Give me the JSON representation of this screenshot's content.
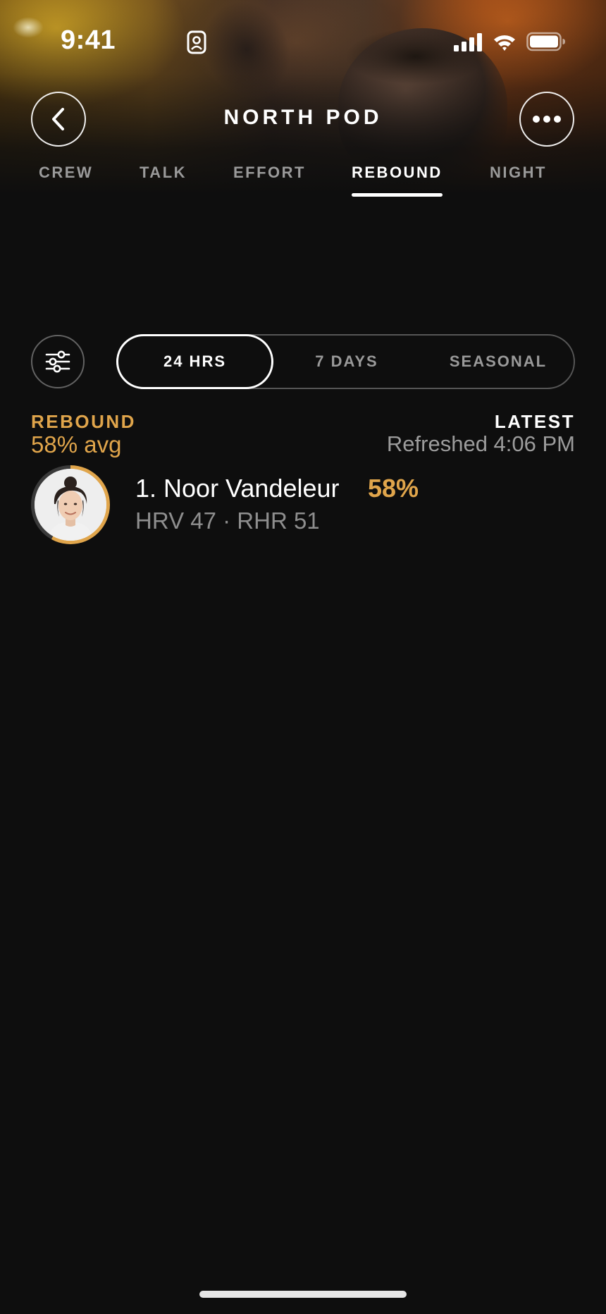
{
  "status_bar": {
    "time": "9:41",
    "icons": [
      "contact-card-icon",
      "cellular-signal-icon",
      "wifi-icon",
      "battery-icon"
    ]
  },
  "header": {
    "title": "NORTH POD",
    "back_icon": "chevron-left-icon",
    "more_icon": "ellipsis-icon"
  },
  "tabs": [
    {
      "label": "CREW",
      "active": false
    },
    {
      "label": "TALK",
      "active": false
    },
    {
      "label": "EFFORT",
      "active": false
    },
    {
      "label": "REBOUND",
      "active": true
    },
    {
      "label": "NIGHT",
      "active": false
    }
  ],
  "filter": {
    "icon": "sliders-icon",
    "segments": [
      {
        "label": "24 HRS",
        "active": true
      },
      {
        "label": "7 DAYS",
        "active": false
      },
      {
        "label": "SEASONAL",
        "active": false
      }
    ]
  },
  "summary": {
    "label": "REBOUND",
    "avg": "58% avg",
    "latest_label": "LATEST",
    "refreshed": "Refreshed 4:06 PM"
  },
  "members": [
    {
      "name": "1. Noor Vandeleur",
      "score": "58%",
      "score_fraction": 0.58,
      "stats": "HRV 47 · RHR 51"
    }
  ],
  "colors": {
    "accent": "#e0a54b",
    "background": "#0e0e0e",
    "muted_text": "#9a9a9a",
    "ring_track": "#3a3a3a"
  }
}
